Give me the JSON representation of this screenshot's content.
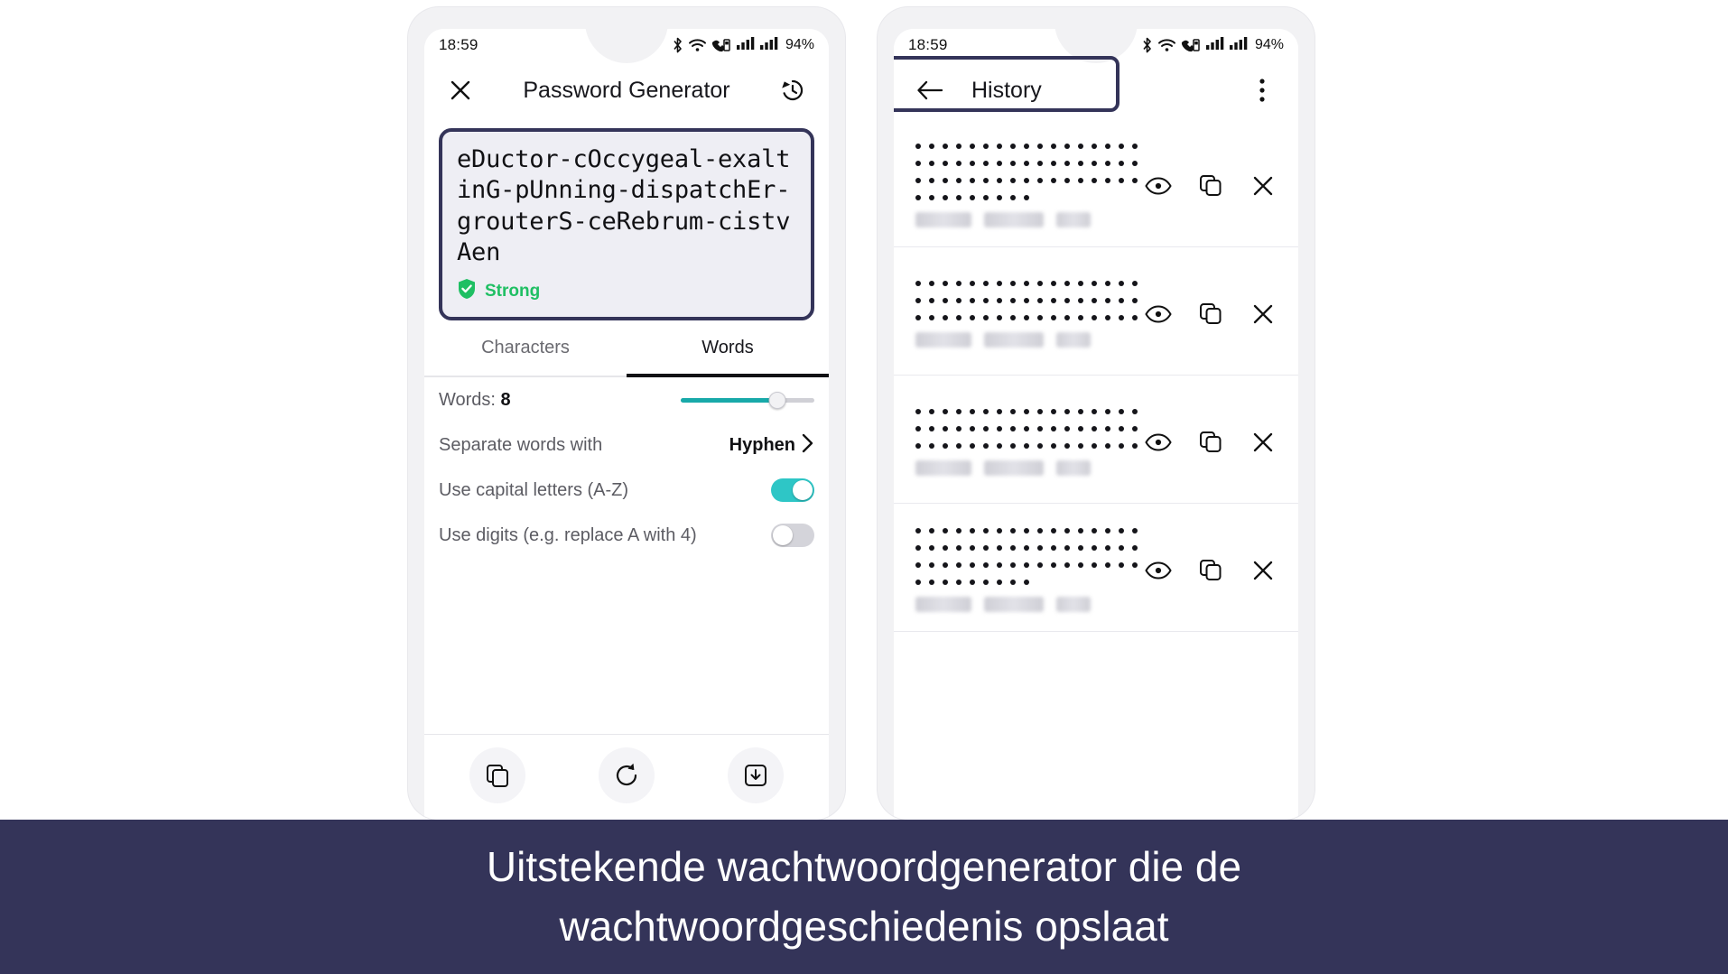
{
  "status_bar": {
    "time": "18:59",
    "battery": "94%",
    "icons": [
      "bluetooth-icon",
      "wifi-icon",
      "call-data-icon",
      "signal-bars-icon",
      "signal-bars-icon"
    ]
  },
  "left_phone": {
    "appbar": {
      "close_label": "close-icon",
      "title": "Password Generator",
      "history_label": "history-icon"
    },
    "password": {
      "value": "eDuctor-cOccygeal-exaltinG-pUnning-dispatchEr-grouterS-ceRebrum-cistvAen",
      "strength": "Strong",
      "strength_color": "#1fbf63",
      "border_color": "#343459",
      "background": "#eeeef4"
    },
    "tabs": [
      {
        "label": "Characters",
        "active": false
      },
      {
        "label": "Words",
        "active": true
      }
    ],
    "settings": [
      {
        "type": "slider",
        "label_prefix": "Words: ",
        "value": "8",
        "fill_percent": "72",
        "accent": "#18a9a9"
      },
      {
        "type": "nav",
        "label": "Separate words with",
        "value": "Hyphen",
        "chevron": "chevron-right-icon"
      },
      {
        "type": "toggle",
        "label": "Use capital letters (A-Z)",
        "on": true,
        "accent": "#2ec6c6"
      },
      {
        "type": "toggle",
        "label": "Use digits (e.g. replace A with 4)",
        "on": false,
        "accent": "#d4d4da"
      }
    ],
    "bottom_actions": [
      "copy-icon",
      "regenerate-icon",
      "save-icon"
    ]
  },
  "right_phone": {
    "appbar": {
      "back_label": "back-arrow-icon",
      "title": "History",
      "menu_label": "more-options-icon",
      "highlight_color": "#343459"
    },
    "history_items": [
      {
        "dot_rows": [
          17,
          17,
          17,
          9
        ],
        "actions": [
          "eye-icon",
          "copy-icon",
          "close-icon"
        ]
      },
      {
        "dot_rows": [
          17,
          17,
          17
        ],
        "actions": [
          "eye-icon",
          "copy-icon",
          "close-icon"
        ]
      },
      {
        "dot_rows": [
          17,
          17,
          17
        ],
        "actions": [
          "eye-icon",
          "copy-icon",
          "close-icon"
        ]
      },
      {
        "dot_rows": [
          17,
          17,
          17,
          9
        ],
        "actions": [
          "eye-icon",
          "copy-icon",
          "close-icon"
        ]
      }
    ]
  },
  "caption": {
    "line1": "Uitstekende wachtwoordgenerator die de",
    "line2": "wachtwoordgeschiedenis opslaat",
    "background": "#343459",
    "color": "#ffffff"
  }
}
